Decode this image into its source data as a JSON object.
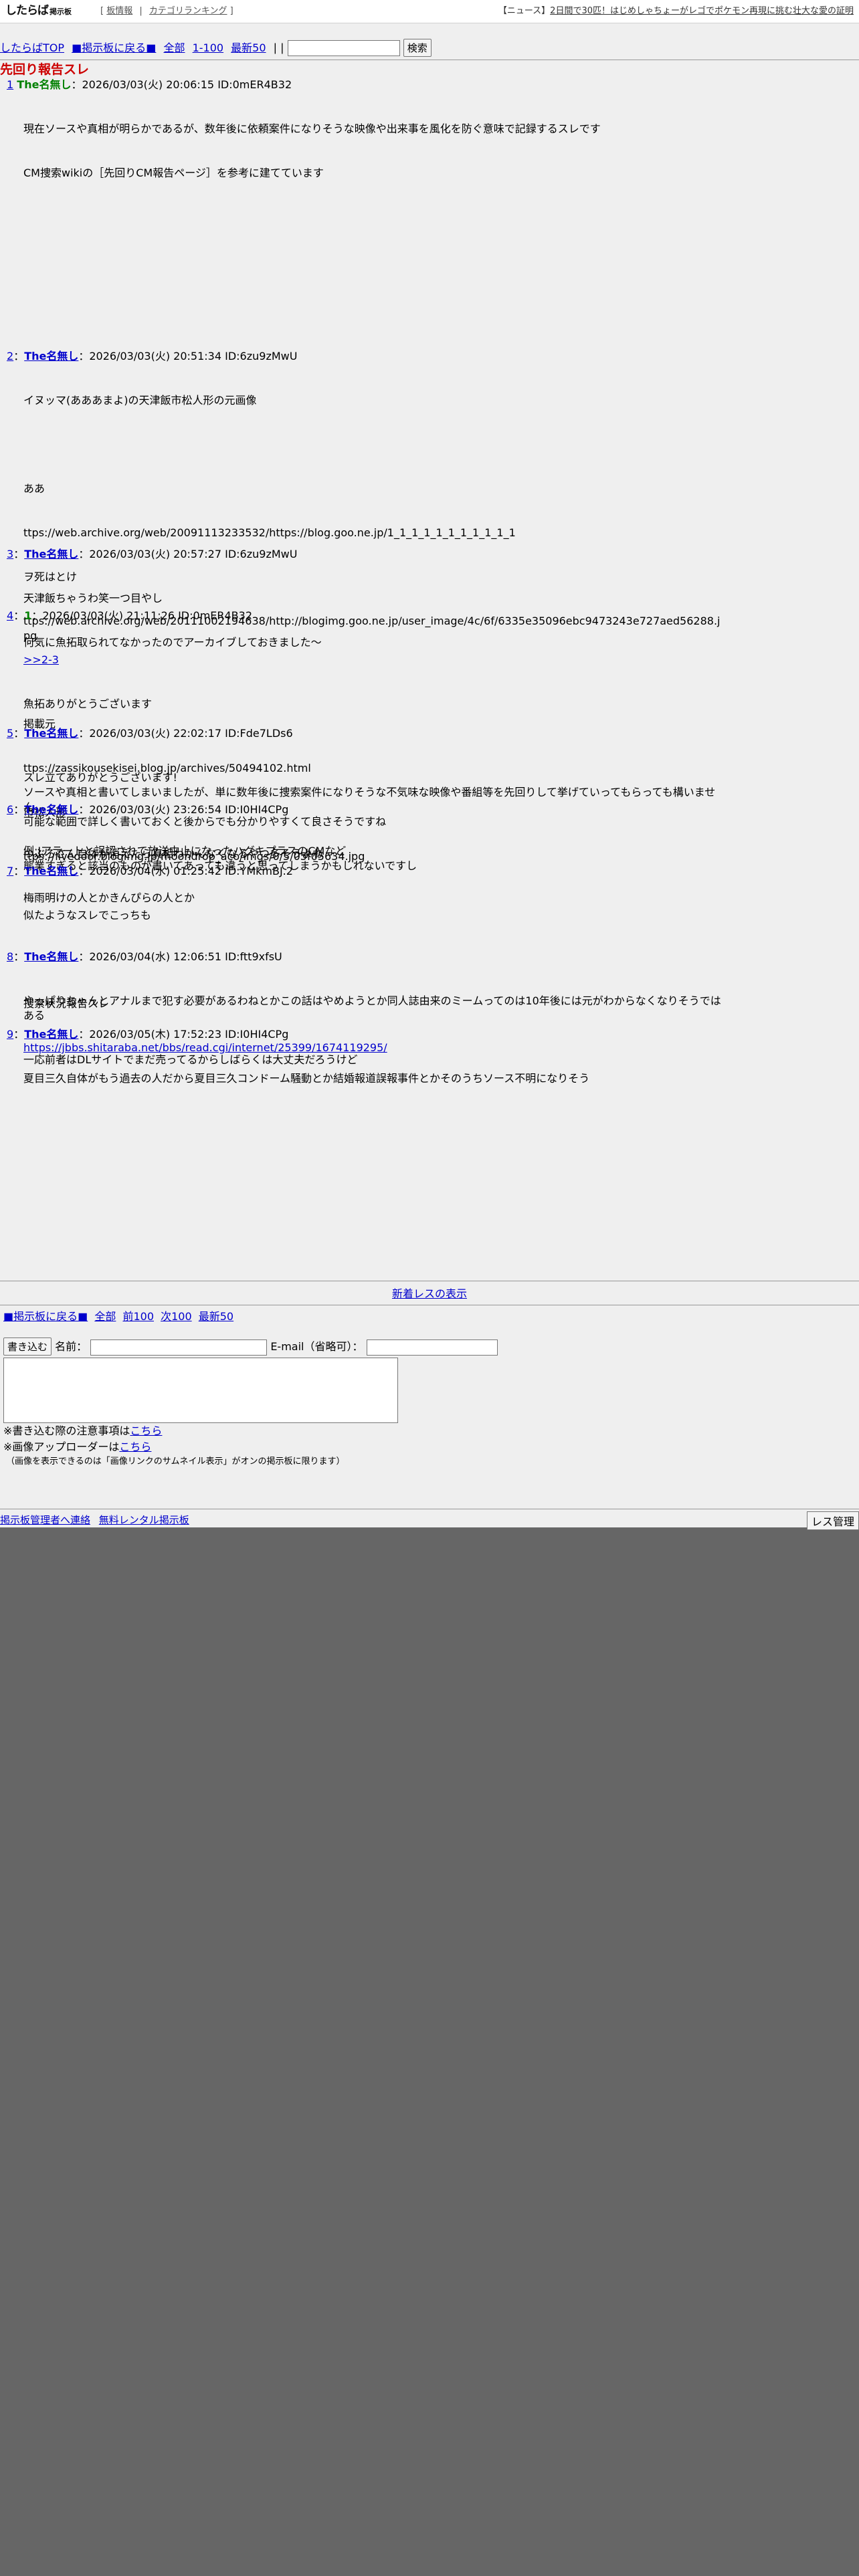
{
  "header": {
    "logo_text": "したらば",
    "logo_sub": "掲示板",
    "nav_open": "[",
    "nav_info": "板情報",
    "nav_sep": "|",
    "nav_ranking": "カテゴリランキング",
    "nav_close": "]",
    "news_label": "【ニュース】",
    "news_link": "2日間で30匹！はじめしゃちょーがレゴでポケモン再現に挑む壮大な愛の証明"
  },
  "nav": {
    "top": "したらばTOP",
    "board_back": "■掲示板に戻る■",
    "all": "全部",
    "range": "1-100",
    "latest": "最新50",
    "sep": "| |",
    "search_placeholder": "",
    "search_button": "検索"
  },
  "thread": {
    "title": "先回り報告スレ"
  },
  "posts": [
    {
      "num": "1",
      "name": "The名無し",
      "meta": "：2026/03/03(火) 20:06:15 ID:0mER4B32",
      "lines": [
        "現在ソースや真相が明らかであるが、数年後に依頼案件になりそうな映像や出来事を風化を防ぐ意味で記録するスレです",
        "CM捜索wikiの［先回りCM報告ページ］を参考に建てています"
      ]
    },
    {
      "num": "2",
      "name": "The名無し",
      "meta": "：2026/03/03(火) 20:51:34 ID:6zu9zMwU",
      "lines": [
        "イヌッマ(あああまよ)の天津飯市松人形の元画像",
        "",
        "ああ",
        "ttps://web.archive.org/web/20091113233532/https://blog.goo.ne.jp/1_1_1_1_1_1_1_1_1_1_1",
        "ヲ死はとけ",
        "ttps://web.archive.org/web/20111002194638/http://blogimg.goo.ne.jp/user_image/4c/6f/6335e35096ebc9473243e727aed56288.jpg",
        "",
        "掲載元",
        "ttps://zassikousekisei.blog.jp/archives/50494102.html",
        "市松人形",
        "ttps://livedoor.blogimg.jp/moondrop_aco/imgs/0/5/05f05634.jpg"
      ]
    },
    {
      "num": "3",
      "name": "The名無し",
      "meta": "：2026/03/03(火) 20:57:27 ID:6zu9zMwU",
      "lines": [
        "天津飯ちゃうわ笑一つ目やし",
        "何気に魚拓取られてなかったのでアーカイブしておきました〜"
      ]
    },
    {
      "num": "4",
      "name": "1",
      "meta": "：2026/03/03(火) 21:11:26 ID:0mER4B32",
      "lines": [
        ">>2-3",
        "魚拓ありがとうございます",
        "",
        "ソースや真相と書いてしまいましたが、単に数年後に捜索案件になりそうな不気味な映像や番組等を先回りして挙げていってもらっても構いません",
        "例:Jアラートと誤認されて放送中止になったハグキプラスのCMなど"
      ]
    },
    {
      "num": "5",
      "name": "The名無し",
      "meta": "：2026/03/03(火) 22:02:17 ID:Fde7LDs6",
      "lines": [
        "スレ立てありがとうございます!",
        "可能な範囲で詳しく書いておくと後からでも分かりやすくて良さそうですね",
        "態業すぎると該当のものが書いてあっても違うと思ってしまうかもしれないですし"
      ]
    },
    {
      "num": "6",
      "name": "The名無し",
      "meta": "：2026/03/03(火) 23:26:54 ID:I0HI4CPg",
      "lines": [
        "つぶろさん自体が消えたら真相わかんなくなるやつ多そうよね",
        "梅雨明けの人とかきんぴらの人とか"
      ]
    },
    {
      "num": "7",
      "name": "The名無し",
      "meta": "：2026/03/04(水) 01:25:42 ID:YMkmBJ.2",
      "lines": [
        "似たようなスレでこっちも",
        "",
        "捜索状況報告スレ",
        "https://jbbs.shitaraba.net/bbs/read.cgi/internet/25399/1674119295/"
      ]
    },
    {
      "num": "8",
      "name": "The名無し",
      "meta": "：2026/03/04(水) 12:06:51 ID:ftt9xfsU",
      "lines": [
        "やっぱりちゃんとアナルまで犯す必要があるわねとかこの話はやめようとか同人誌由来のミームってのは10年後には元がわからなくなりそうではある",
        "一応前者はDLサイトでまだ売ってるからしばらくは大丈夫だろうけど"
      ]
    },
    {
      "num": "9",
      "name": "The名無し",
      "meta": "：2026/03/05(木) 17:52:23 ID:I0HI4CPg",
      "lines": [
        "夏目三久自体がもう過去の人だから夏目三久コンドーム騒動とか結婚報道誤報事件とかそのうちソース不明になりそう"
      ]
    }
  ],
  "footer_nav": {
    "new_res": "新着レスの表示",
    "board_back": "■掲示板に戻る■",
    "all": "全部",
    "prev": "前100",
    "next": "次100",
    "latest": "最新50"
  },
  "form": {
    "submit": "書き込む",
    "name_label": "名前：",
    "email_label": "E-mail（省略可）：",
    "name_value": "",
    "email_value": ""
  },
  "notes": {
    "rules_prefix": "※書き込む際の注意事項は",
    "rules_link": "こちら",
    "uploader_prefix": "※画像アップローダーは",
    "uploader_link": "こちら",
    "image_note": "（画像を表示できるのは「画像リンクのサムネイル表示」がオンの掲示板に限ります）"
  },
  "footer": {
    "contact": "掲示板管理者へ連絡",
    "rental": "無料レンタル掲示板",
    "admin": "レス管理"
  }
}
